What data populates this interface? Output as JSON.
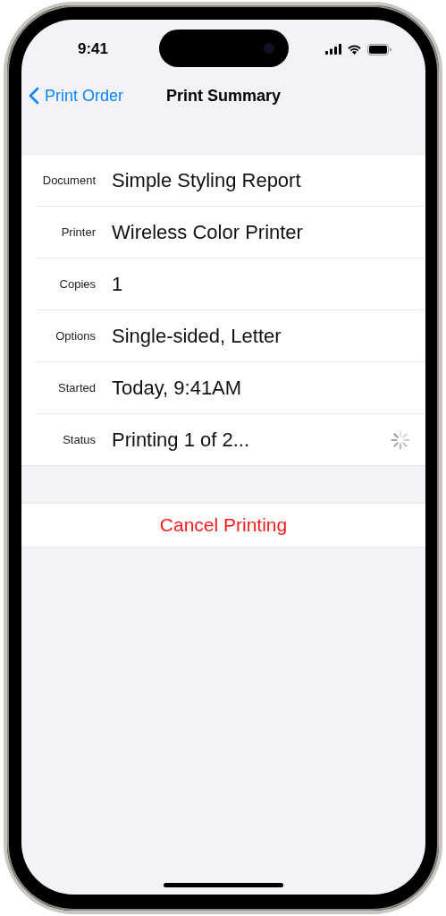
{
  "status_bar": {
    "time": "9:41"
  },
  "nav_bar": {
    "back": "Print Order",
    "title": "Print Summary"
  },
  "details": [
    {
      "label": "Document",
      "value": "Simple Styling Report",
      "kind": "text"
    },
    {
      "label": "Printer",
      "value": "Wireless Color Printer",
      "kind": "text"
    },
    {
      "label": "Copies",
      "value": "1",
      "kind": "text"
    },
    {
      "label": "Options",
      "value": "Single-sided, Letter",
      "kind": "text"
    },
    {
      "label": "Started",
      "value": "Today, 9:41AM",
      "kind": "text"
    },
    {
      "label": "Status",
      "value": "Printing 1 of 2...",
      "kind": "activity"
    }
  ],
  "cancel_button": {
    "label": "Cancel Printing"
  }
}
